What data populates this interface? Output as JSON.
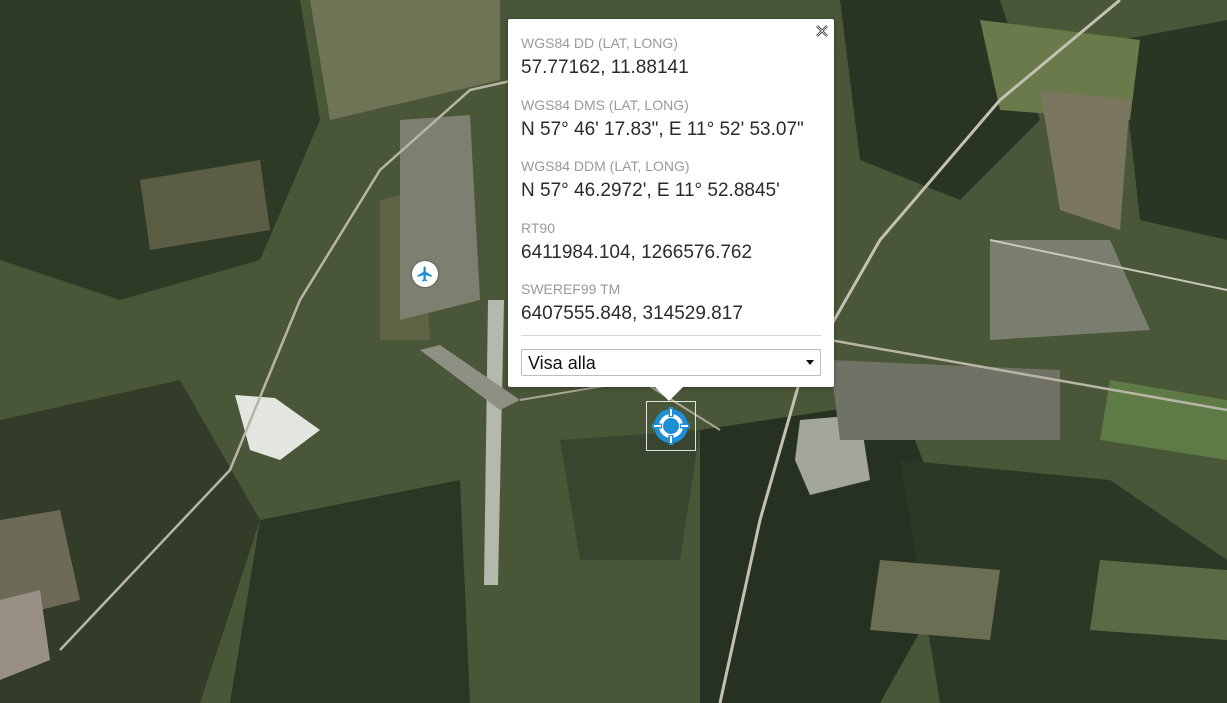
{
  "popup": {
    "close_icon": "close-icon",
    "coordinates": [
      {
        "label": "WGS84 DD (LAT, LONG)",
        "value": "57.77162, 11.88141"
      },
      {
        "label": "WGS84 DMS (LAT, LONG)",
        "value": "N 57° 46' 17.83\", E 11° 52' 53.07\""
      },
      {
        "label": "WGS84 DDM (LAT, LONG)",
        "value": "N 57° 46.2972', E 11° 52.8845'"
      },
      {
        "label": "RT90",
        "value": "6411984.104, 1266576.762"
      },
      {
        "label": "SWEREF99 TM",
        "value": "6407555.848, 314529.817"
      }
    ],
    "select": {
      "selected": "Visa alla"
    }
  },
  "markers": {
    "airport_icon": "airplane-icon",
    "location_icon": "crosshair-location-icon"
  },
  "colors": {
    "marker_blue": "#1e8fd6",
    "popup_bg": "#ffffff",
    "label_gray": "#9a9a9a"
  }
}
